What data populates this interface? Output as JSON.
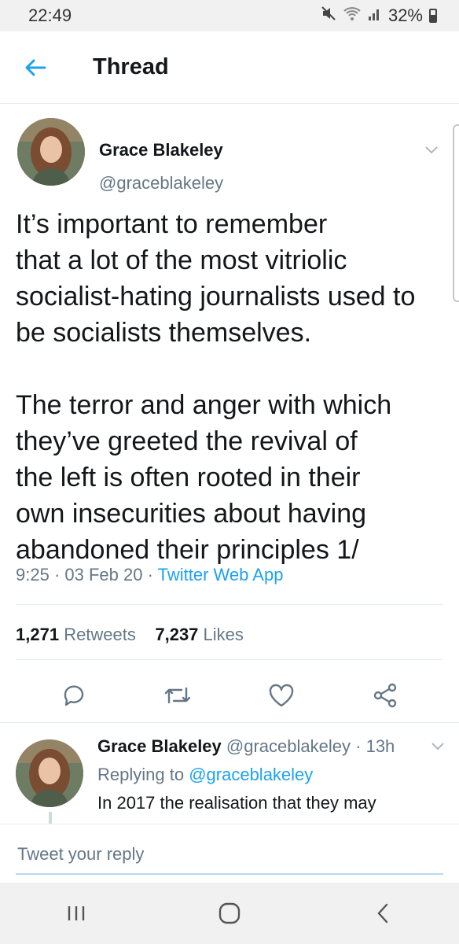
{
  "status_bar": {
    "time": "22:49",
    "battery": "32%",
    "icons": [
      "mute-icon",
      "wifi-icon",
      "signal-icon",
      "battery-icon"
    ]
  },
  "header": {
    "title": "Thread",
    "back_icon": "arrow-left-icon"
  },
  "tweet": {
    "author_name": "Grace Blakeley",
    "author_handle": "@graceblakeley",
    "text": "It’s important to remember\nthat a lot of the most vitriolic\nsocialist-hating journalists used to\nbe socialists themselves.\n\nThe terror and anger with which\nthey’ve greeted the revival of\nthe left is often rooted in their\nown insecurities about having\nabandoned their principles 1/",
    "time": "9:25",
    "date": "03 Feb 20",
    "source": "Twitter Web App",
    "retweets_count": "1,271",
    "retweets_label": "Retweets",
    "likes_count": "7,237",
    "likes_label": "Likes"
  },
  "reply": {
    "author_name": "Grace Blakeley",
    "author_handle": "@graceblakeley",
    "age": "13h",
    "replying_prefix": "Replying to",
    "replying_to": "@graceblakeley",
    "text": "In 2017 the realisation that they may"
  },
  "compose": {
    "placeholder": "Tweet your reply"
  },
  "colors": {
    "accent": "#1da1f2",
    "muted": "#657786",
    "text": "#14171a"
  }
}
